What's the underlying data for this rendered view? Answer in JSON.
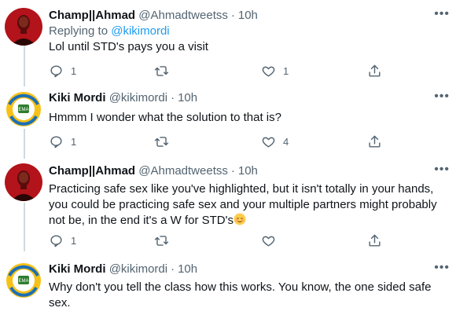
{
  "tweets": [
    {
      "name": "Champ||Ahmad",
      "handle": "@Ahmadtweetss",
      "time": "10h",
      "replying_label": "Replying to",
      "replying_to": "@kikimordi",
      "text": "Lol until STD's pays you a visit",
      "reply_count": "1",
      "retweet_count": "",
      "like_count": "1",
      "avatar": "red-portrait-avatar"
    },
    {
      "name": "Kiki Mordi",
      "handle": "@kikimordi",
      "time": "10h",
      "text": "Hmmm I wonder what the solution to that is?",
      "reply_count": "1",
      "retweet_count": "",
      "like_count": "4",
      "avatar": "generation-change-logo-avatar"
    },
    {
      "name": "Champ||Ahmad",
      "handle": "@Ahmadtweetss",
      "time": "10h",
      "text": "Practicing safe sex like you've highlighted, but it isn't totally in your hands, you could be practicing safe sex and your multiple partners might probably not be, in the end it's a W for STD's",
      "reply_count": "1",
      "retweet_count": "",
      "like_count": "",
      "avatar": "red-portrait-avatar"
    },
    {
      "name": "Kiki Mordi",
      "handle": "@kikimordi",
      "time": "10h",
      "text": "Why don't you tell the class how this works. You know, the one sided safe sex.",
      "avatar": "generation-change-logo-avatar"
    }
  ],
  "colors": {
    "text": "#0f1419",
    "secondary": "#536471",
    "link": "#1d9bf0",
    "thread": "#cfd9de",
    "avatar_red": "#b3131a"
  },
  "icons": [
    "more-icon",
    "reply-icon",
    "retweet-icon",
    "like-icon",
    "share-icon",
    "relieved-face-emoji"
  ]
}
